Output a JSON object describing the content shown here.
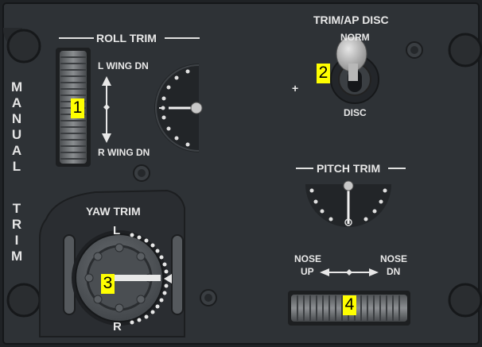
{
  "panel_title": [
    "M",
    "A",
    "N",
    "U",
    "A",
    "L",
    "",
    "T",
    "R",
    "I",
    "M"
  ],
  "roll_trim": {
    "title": "ROLL TRIM",
    "up_label": "L WING DN",
    "down_label": "R WING DN"
  },
  "yaw_trim": {
    "title": "YAW TRIM",
    "left_label": "L",
    "right_label": "R"
  },
  "disc_switch": {
    "title": "TRIM/AP DISC",
    "top_label": "NORM",
    "bottom_label": "DISC",
    "plus_label": "+"
  },
  "pitch_trim": {
    "title": "PITCH TRIM",
    "left_top": "NOSE",
    "left_bottom": "UP",
    "right_top": "NOSE",
    "right_bottom": "DN"
  },
  "callouts": [
    "1",
    "2",
    "3",
    "4"
  ],
  "colors": {
    "panel": "#2e3236",
    "text": "#e8e8e8",
    "callout": "#ffff00"
  }
}
